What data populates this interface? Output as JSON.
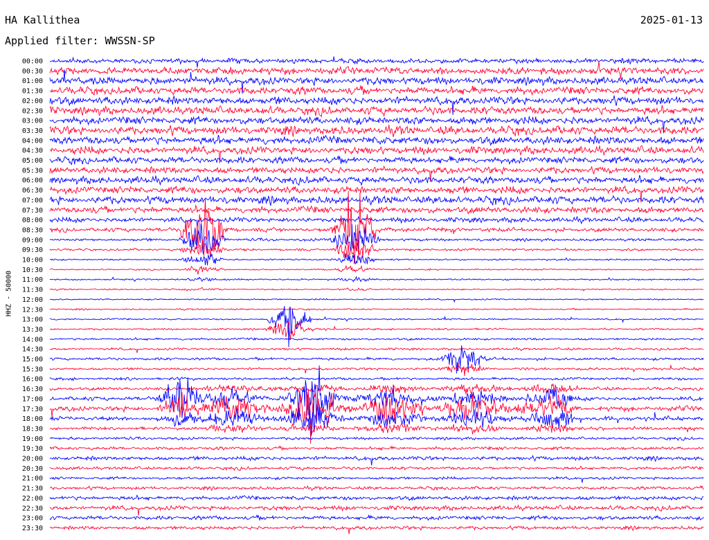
{
  "header": {
    "station": "HA Kallithea",
    "date": "2025-01-13",
    "filter_label": "Applied filter: WWSSN-SP"
  },
  "chart_data": {
    "type": "line",
    "title": "HA Kallithea",
    "subtitle": "Applied filter: WWSSN-SP",
    "ylabel": "HHZ - 50000",
    "trace_colors": [
      "#0000ff",
      "#ff0033"
    ],
    "rows": [
      "00:00",
      "00:30",
      "01:00",
      "01:30",
      "02:00",
      "02:30",
      "03:00",
      "03:30",
      "04:00",
      "04:30",
      "05:00",
      "05:30",
      "06:00",
      "06:30",
      "07:00",
      "07:30",
      "08:00",
      "08:30",
      "09:00",
      "09:30",
      "10:00",
      "10:30",
      "11:00",
      "11:30",
      "12:00",
      "12:30",
      "13:00",
      "13:30",
      "14:00",
      "14:30",
      "15:00",
      "15:30",
      "16:00",
      "16:30",
      "17:00",
      "17:30",
      "18:00",
      "18:30",
      "19:00",
      "19:30",
      "20:00",
      "20:30",
      "21:00",
      "21:30",
      "22:00",
      "22:30",
      "23:00",
      "23:30"
    ],
    "activity_by_row": [
      0.55,
      0.8,
      0.85,
      0.85,
      0.9,
      0.9,
      0.85,
      0.95,
      0.9,
      0.85,
      0.75,
      0.75,
      0.8,
      0.8,
      0.85,
      0.75,
      0.55,
      0.45,
      0.3,
      0.25,
      0.18,
      0.16,
      0.18,
      0.16,
      0.16,
      0.16,
      0.18,
      0.2,
      0.25,
      0.25,
      0.3,
      0.28,
      0.3,
      0.35,
      0.45,
      0.55,
      0.45,
      0.35,
      0.3,
      0.35,
      0.45,
      0.35,
      0.3,
      0.35,
      0.45,
      0.5,
      0.45,
      0.4
    ],
    "events": [
      {
        "row": 17,
        "minute": 7,
        "amplitude": 8,
        "duration_rows": 7
      },
      {
        "row": 17,
        "minute": 14,
        "amplitude": 8,
        "duration_rows": 7
      },
      {
        "row": 26,
        "minute": 11,
        "amplitude": 4,
        "duration_rows": 2
      },
      {
        "row": 30,
        "minute": 19,
        "amplitude": 3,
        "duration_rows": 2
      },
      {
        "row": 34,
        "minute": 6,
        "amplitude": 5,
        "duration_rows": 3
      },
      {
        "row": 34,
        "minute": 12,
        "amplitude": 5,
        "duration_rows": 3
      }
    ],
    "burst": {
      "row_start": 33,
      "row_end": 37,
      "minute_start": 7,
      "minute_end": 24
    }
  }
}
